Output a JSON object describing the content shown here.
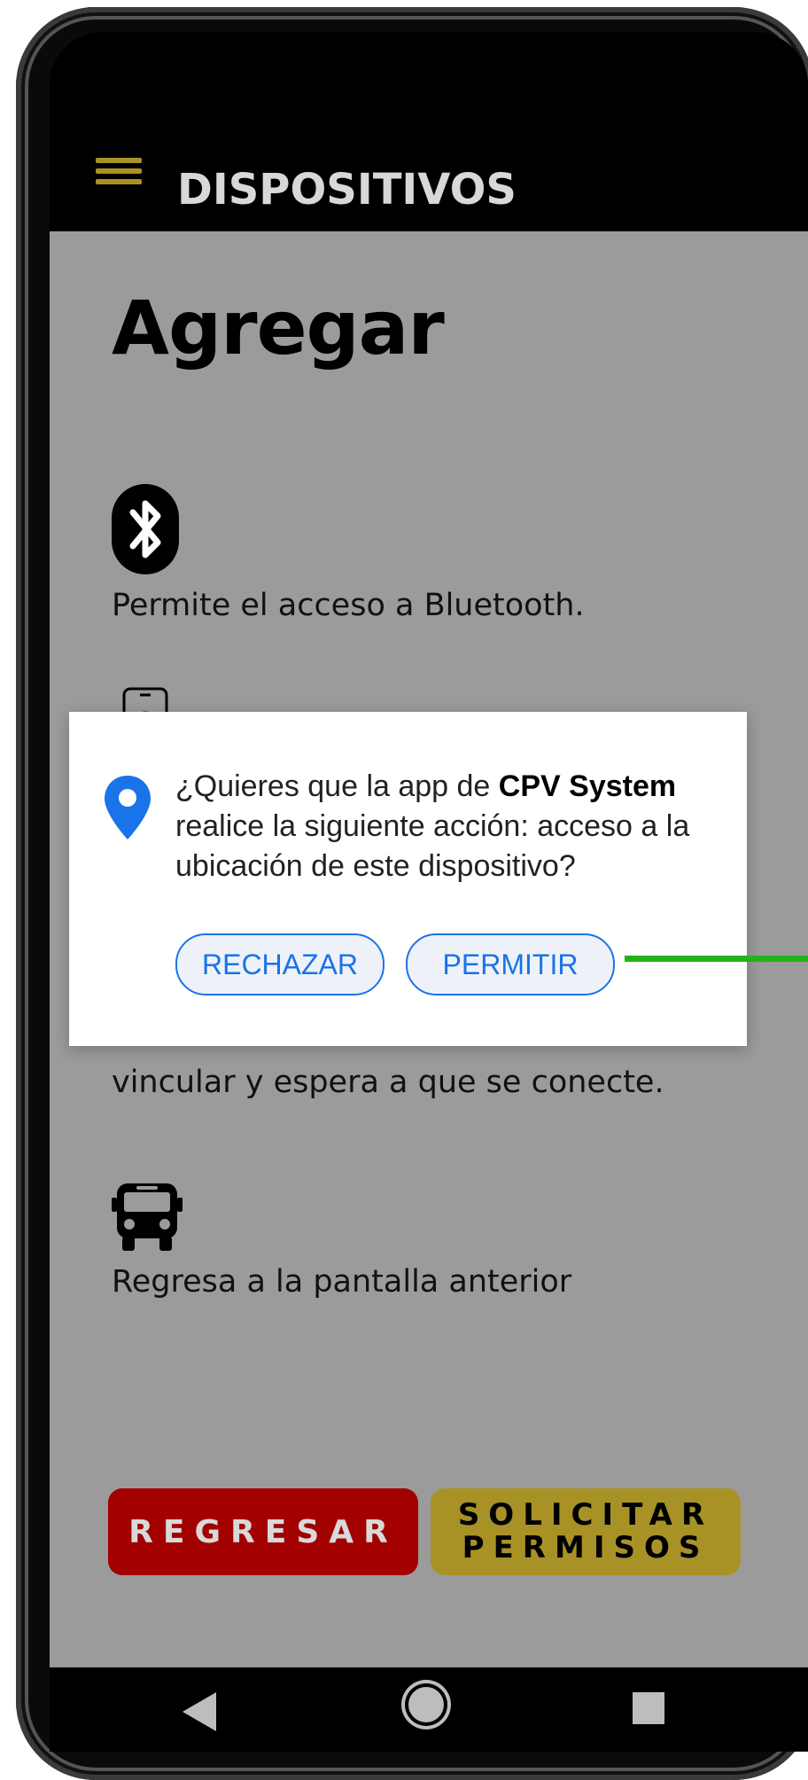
{
  "app_bar": {
    "title": "DISPOSITIVOS",
    "menu_icon": "hamburger-menu-icon",
    "accent_color": "#a89226"
  },
  "page": {
    "title": "Agregar",
    "steps": [
      {
        "icon": "bluetooth-icon",
        "text": "Permite el acceso a Bluetooth."
      },
      {
        "icon": "phone-touch-icon",
        "text": "vincular y espera a que se conecte."
      },
      {
        "icon": "bus-icon",
        "text": "Regresa a la pantalla anterior"
      }
    ]
  },
  "buttons": {
    "back_label": "REGRESAR",
    "perm_line1": "SOLICITAR",
    "perm_line2": "PERMISOS",
    "back_color": "#a30000",
    "perm_color": "#a89226"
  },
  "dialog": {
    "text_before": "¿Quieres que la app de ",
    "app_name": "CPV System",
    "text_after": " realice la siguiente acción: acceso a la ubicación de este dispositivo?",
    "reject_label": "RECHAZAR",
    "allow_label": "PERMITIR",
    "icon": "location-pin-icon",
    "accent_color": "#1a73e8"
  },
  "nav_bar": {
    "back_icon": "nav-back-icon",
    "home_icon": "nav-home-icon",
    "recents_icon": "nav-recents-icon"
  }
}
